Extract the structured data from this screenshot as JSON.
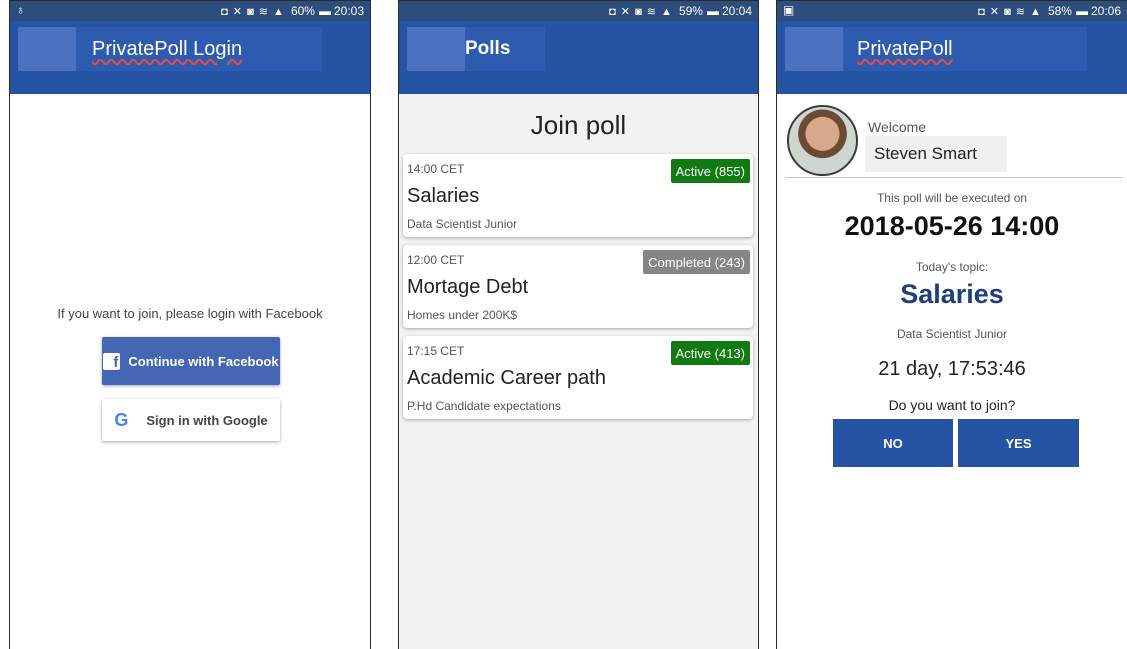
{
  "phone1": {
    "status": {
      "left_icon": "♁",
      "icons": "◘ ✕ ◙ ≋ ▲",
      "battery": "60%",
      "time": "20:03"
    },
    "appbar_title": "PrivatePoll Login",
    "login_text": "If you want to join, please login with Facebook",
    "facebook_button": "Continue with Facebook",
    "facebook_icon": "f",
    "google_button": "Sign in with Google",
    "google_icon": "G"
  },
  "phone2": {
    "status": {
      "icons": "◘ ✕ ◙ ≋ ▲",
      "battery": "59%",
      "time": "20:04"
    },
    "appbar_title": "Polls",
    "heading": "Join poll",
    "polls": [
      {
        "time": "14:00 CET",
        "title": "Salaries",
        "subtitle": "Data Scientist Junior",
        "badge": "Active (855)",
        "status": "active"
      },
      {
        "time": "12:00 CET",
        "title": "Mortage Debt",
        "subtitle": "Homes under 200K$",
        "badge": "Completed (243)",
        "status": "completed"
      },
      {
        "time": "17:15 CET",
        "title": "Academic Career path",
        "subtitle": "P.Hd Candidate expectations",
        "badge": "Active (413)",
        "status": "active"
      }
    ]
  },
  "phone3": {
    "status": {
      "left_icon": "▣",
      "icons": "◘ ✕ ◙ ≋ ▲",
      "battery": "58%",
      "time": "20:06"
    },
    "appbar_title": "PrivatePoll",
    "welcome": "Welcome",
    "user_name": "Steven Smart",
    "executed_note": "This poll will be executed on",
    "date": "2018-05-26 14:00",
    "topic_label": "Today's topic:",
    "topic": "Salaries",
    "subtopic": "Data Scientist Junior",
    "countdown": "21 day, 17:53:46",
    "question": "Do you want to join?",
    "no_button": "NO",
    "yes_button": "YES"
  },
  "colors": {
    "appbar": "#2653a3",
    "statusbar": "#2d4d7d",
    "active": "#117a11",
    "completed": "#868686",
    "topic": "#1f3f7a"
  }
}
